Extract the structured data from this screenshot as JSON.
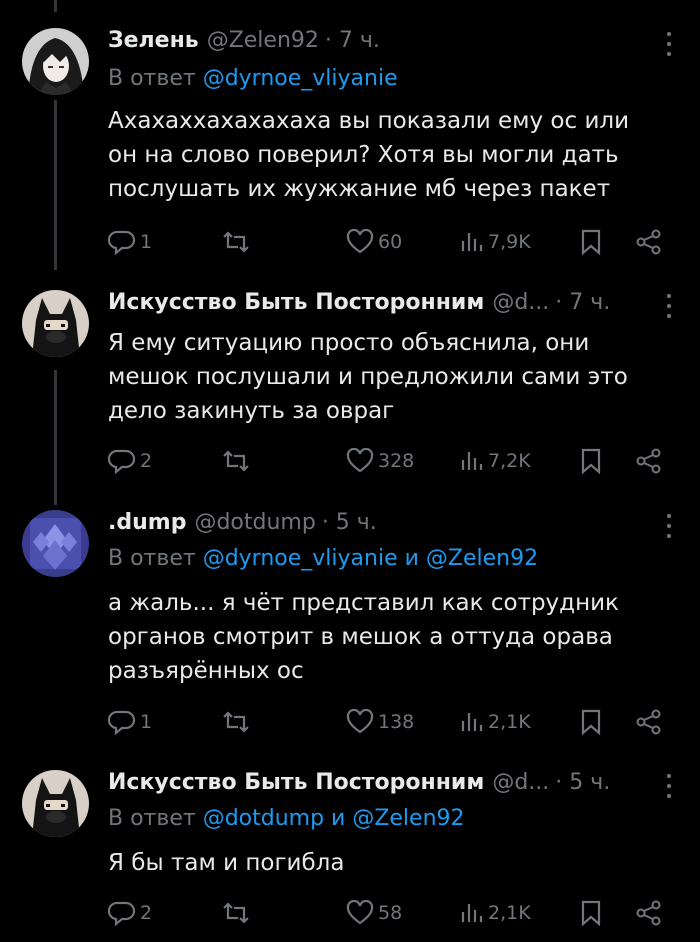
{
  "tweets": [
    {
      "name": "Зелень",
      "handle": "@Zelen92",
      "time": "· 7 ч.",
      "reply_prefix": "В ответ",
      "reply_to": "@dyrnoe_vliyanie",
      "text": [
        "Ахахаххахахахаха вы показали ему ос или",
        "он на слово поверил? Хотя вы могли дать",
        "послушать их жужжание мб через пакет"
      ],
      "replies": "1",
      "reposts": "",
      "likes": "60",
      "views": "7,9K"
    },
    {
      "name": "Искусство Быть Посторонним",
      "handle": "@d...",
      "time": "· 7 ч.",
      "reply_prefix": "",
      "reply_to": "",
      "text": [
        "Я ему ситуацию просто объяснила, они",
        "мешок послушали и предложили сами это",
        "дело закинуть за овраг"
      ],
      "replies": "2",
      "reposts": "",
      "likes": "328",
      "views": "7,2K"
    },
    {
      "name": ".dump",
      "handle": "@dotdump",
      "time": "· 5 ч.",
      "reply_prefix": "В ответ",
      "reply_to": "@dyrnoe_vliyanie и @Zelen92",
      "text": [
        "а жаль... я чёт представил как сотрудник",
        "органов смотрит в мешок а оттуда орава",
        "разъярённых ос"
      ],
      "replies": "1",
      "reposts": "",
      "likes": "138",
      "views": "2,1K"
    },
    {
      "name": "Искусство Быть Посторонним",
      "handle": "@d...",
      "time": "· 5 ч.",
      "reply_prefix": "В ответ",
      "reply_to": "@dotdump и @Zelen92",
      "text": [
        "Я бы там и погибла"
      ],
      "replies": "2",
      "reposts": "",
      "likes": "58",
      "views": "2,1K"
    }
  ]
}
